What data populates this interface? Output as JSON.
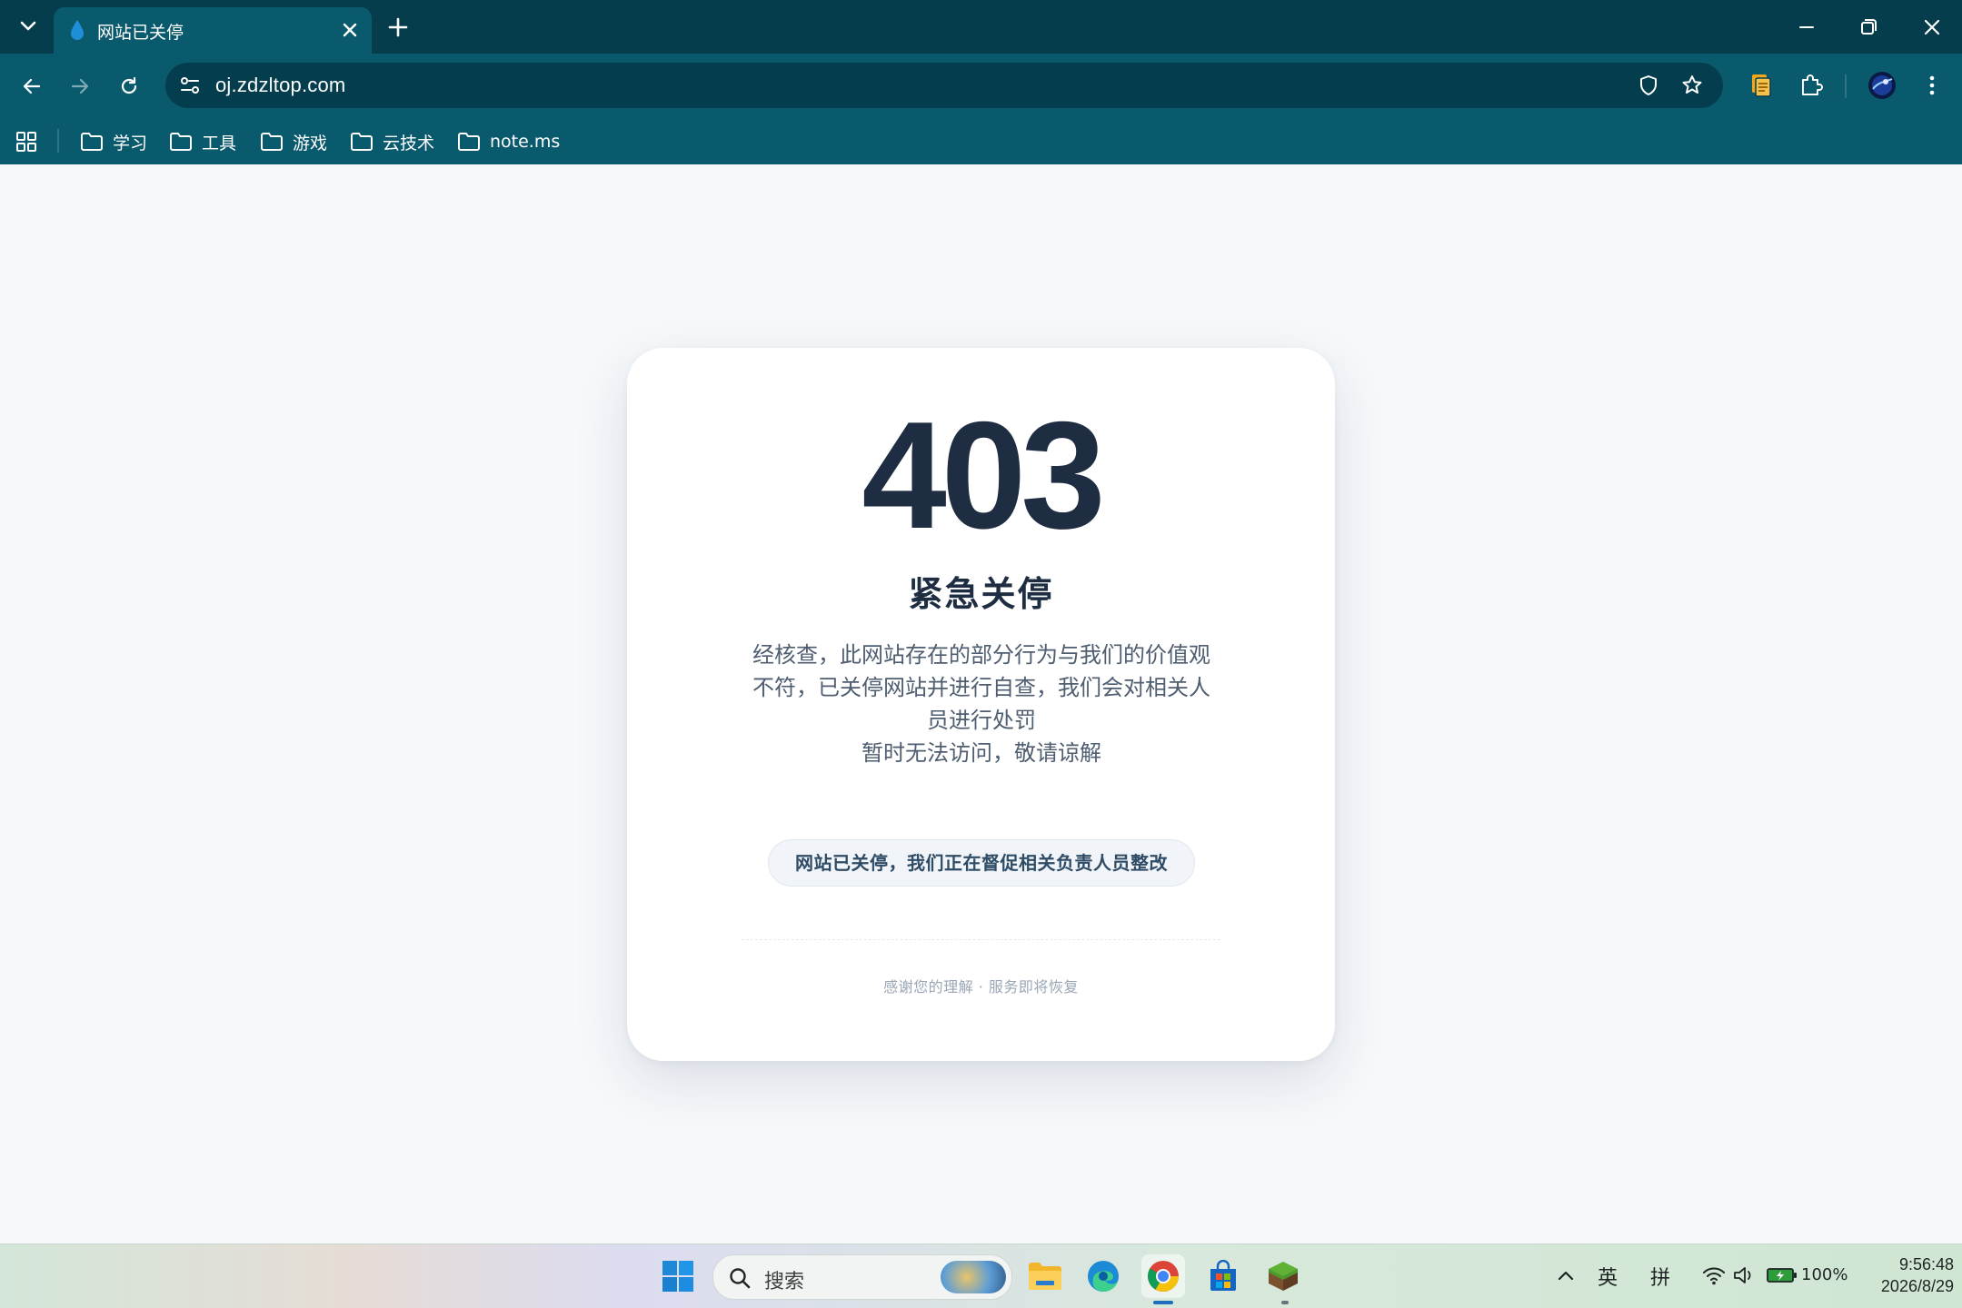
{
  "browser": {
    "tab": {
      "title": "网站已关停"
    },
    "url": "oj.zdzltop.com",
    "bookmarks": [
      {
        "label": "学习"
      },
      {
        "label": "工具"
      },
      {
        "label": "游戏"
      },
      {
        "label": "云技术"
      },
      {
        "label": "note.ms"
      }
    ]
  },
  "page": {
    "code": "403",
    "title": "紧急关停",
    "description_lines": [
      "经核查，此网站存在的部分行为与我们的价值观",
      "不符，已关停网站并进行自查，我们会对相关人",
      "员进行处罚",
      "暂时无法访问，敬请谅解"
    ],
    "notice": "网站已关停，我们正在督促相关负责人员整改",
    "footer": "感谢您的理解 · 服务即将恢复"
  },
  "taskbar": {
    "search_placeholder": "搜索",
    "ime_lang": "英",
    "ime_mode": "拼",
    "battery": "100%",
    "time": "9:56:48",
    "date": "2026/8/29"
  },
  "colors": {
    "chrome_dark": "#053d4d",
    "chrome": "#0a5a6e",
    "page_bg": "#f6f8fb",
    "heading": "#1f2d42"
  }
}
